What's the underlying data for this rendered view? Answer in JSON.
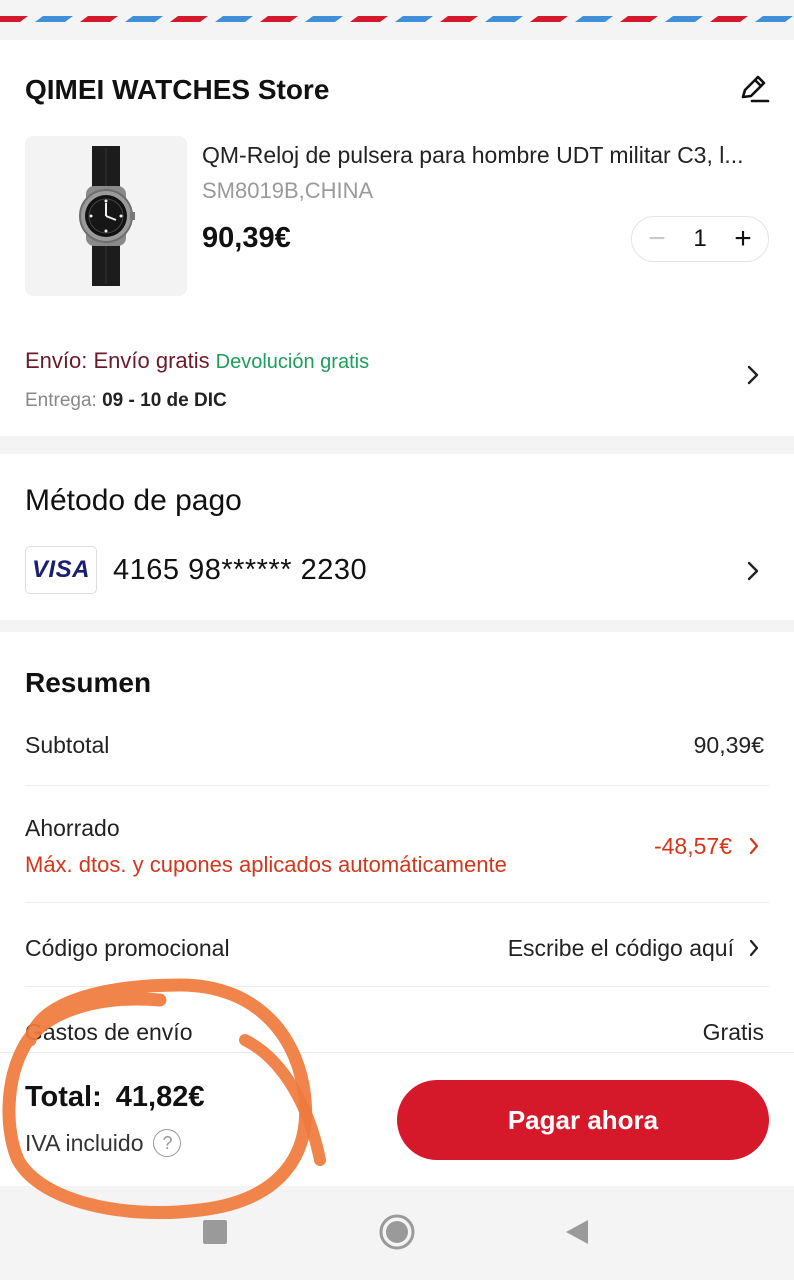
{
  "store": {
    "name": "QIMEI WATCHES Store",
    "edit_icon": "pencil-icon"
  },
  "product": {
    "title": "QM-Reloj de pulsera para hombre UDT militar C3, l...",
    "variant": "SM8019B,CHINA",
    "price": "90,39€",
    "quantity": "1",
    "minus": "−",
    "plus": "+"
  },
  "shipping": {
    "label": "Envío: Envío gratis",
    "return": "Devolución gratis",
    "delivery_prefix": "Entrega:",
    "delivery_dates": "09 - 10 de DIC"
  },
  "payment": {
    "title": "Método de pago",
    "brand": "VISA",
    "card_number": "4165 98****** 2230"
  },
  "summary": {
    "title": "Resumen",
    "subtotal_label": "Subtotal",
    "subtotal_value": "90,39€",
    "saved_label": "Ahorrado",
    "saved_note": "Máx. dtos. y cupones aplicados automáticamente",
    "saved_value": "-48,57€",
    "promo_label": "Código promocional",
    "promo_placeholder": "Escribe el código aquí",
    "shipping_label": "Gastos de envío",
    "shipping_value": "Gratis"
  },
  "footer": {
    "total_label": "Total:",
    "total_value": "41,82€",
    "vat": "IVA incluido",
    "help": "?",
    "pay_button": "Pagar ahora"
  },
  "colors": {
    "accent": "#d6182b",
    "discount": "#d4361c",
    "free_return": "#1e9e5a",
    "shipping_label": "#6b1a2a",
    "annotation": "#f07a3c"
  }
}
